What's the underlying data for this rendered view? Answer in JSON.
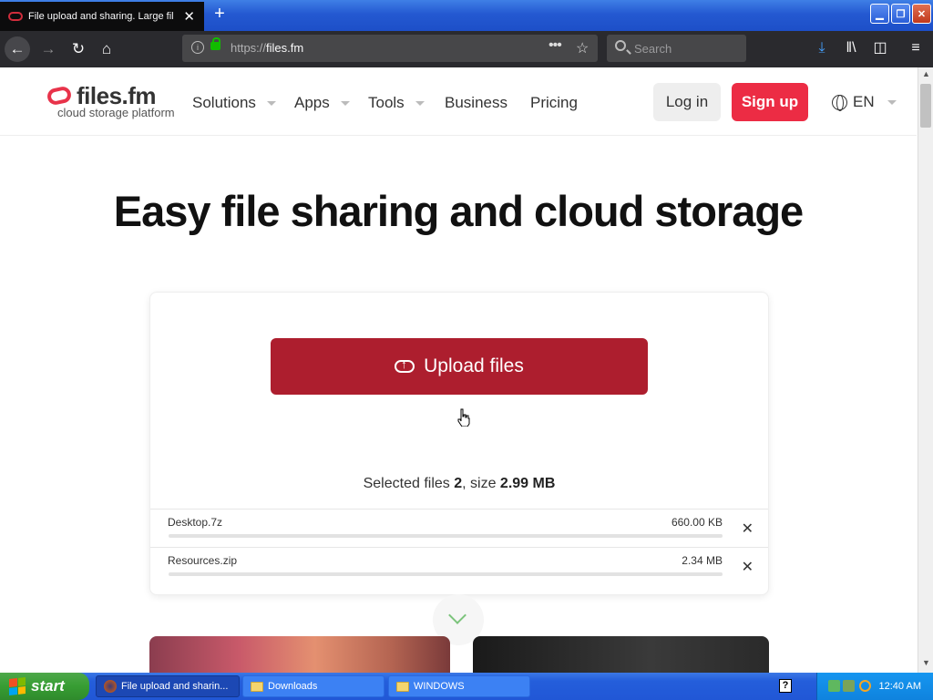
{
  "browser": {
    "tab_title": "File upload and sharing. Large file",
    "tab_close": "✕",
    "newtab": "+",
    "url_protocol": "https://",
    "url_domain": "files.fm",
    "search_placeholder": "Search",
    "window_buttons": {
      "minimize": "▁",
      "restore": "❐",
      "close": "✕"
    }
  },
  "site": {
    "logo": {
      "name": "files.fm",
      "tagline": "cloud storage platform"
    },
    "nav": [
      {
        "label": "Solutions",
        "dropdown": true
      },
      {
        "label": "Apps",
        "dropdown": true
      },
      {
        "label": "Tools",
        "dropdown": true
      },
      {
        "label": "Business",
        "dropdown": false
      },
      {
        "label": "Pricing",
        "dropdown": false
      }
    ],
    "login_label": "Log in",
    "signup_label": "Sign up",
    "language": "EN",
    "hero_title": "Easy file sharing and cloud storage",
    "upload_label": "Upload files",
    "summary": {
      "prefix": "Selected files ",
      "count": "2",
      "middle": ", size ",
      "size": "2.99 MB"
    },
    "files": [
      {
        "name": "Desktop.7z",
        "size": "660.00 KB",
        "remove": "✕",
        "progress": 0
      },
      {
        "name": "Resources.zip",
        "size": "2.34 MB",
        "remove": "✕",
        "progress": 0
      }
    ],
    "colors": {
      "accent": "#ec2c44",
      "upload_button": "#ad1e2e"
    }
  },
  "taskbar": {
    "start_label": "start",
    "items": [
      {
        "label": "File upload and sharin...",
        "active": true,
        "icon": "firefox-icon"
      },
      {
        "label": "Downloads",
        "active": false,
        "icon": "folder-icon"
      },
      {
        "label": "WINDOWS",
        "active": false,
        "icon": "folder-icon"
      }
    ],
    "help": "?",
    "clock": "12:40 AM"
  }
}
